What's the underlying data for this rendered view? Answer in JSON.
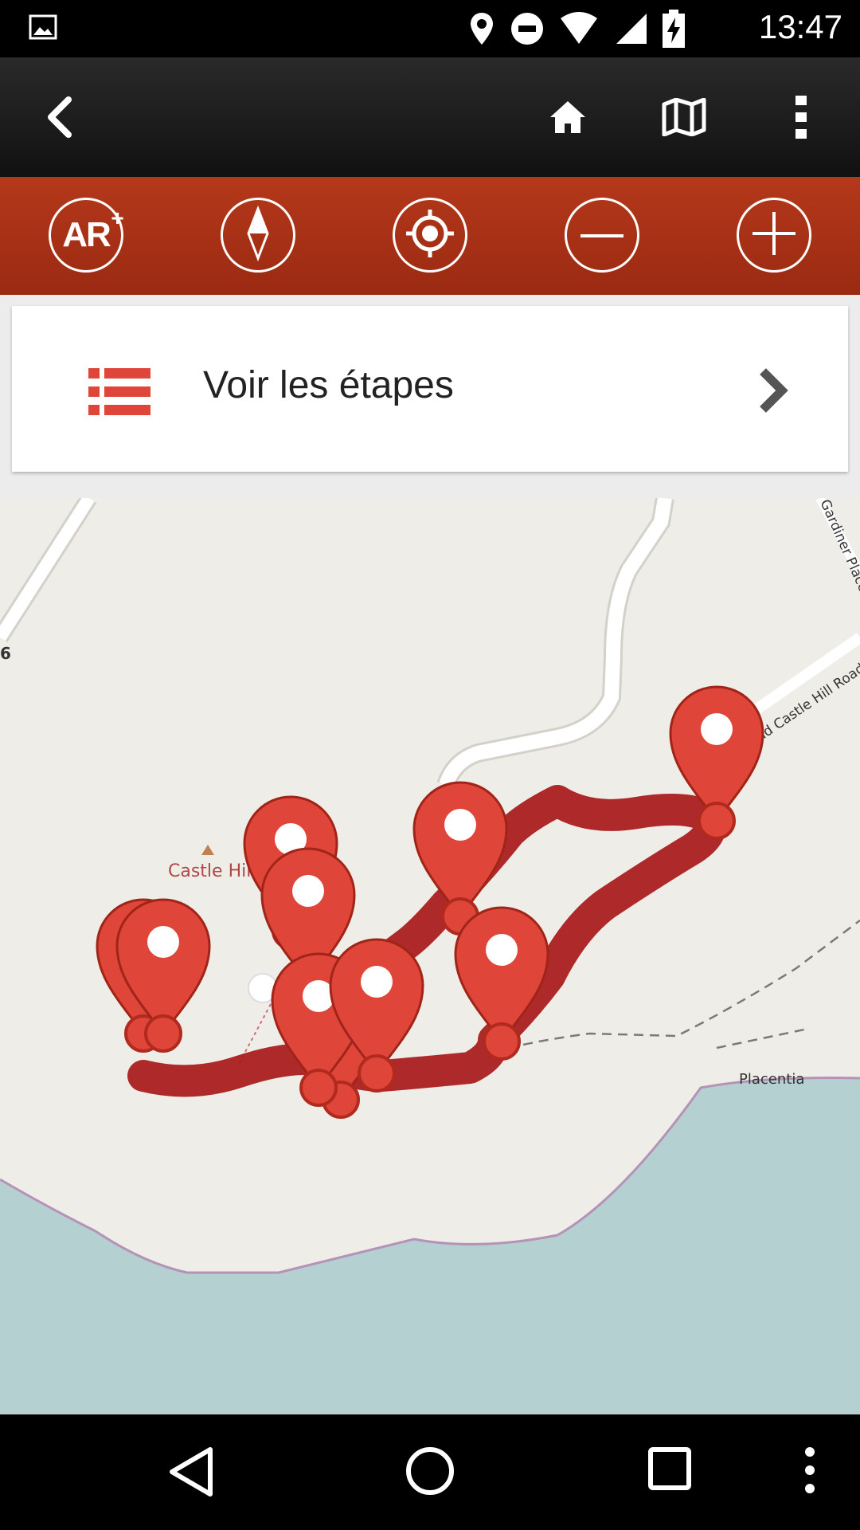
{
  "status_bar": {
    "time": "13:47",
    "icons": [
      "image-icon",
      "location-icon",
      "do-not-disturb-icon",
      "wifi-icon",
      "signal-icon",
      "battery-charging-icon"
    ]
  },
  "app_bar": {
    "icons": [
      "back-icon",
      "home-icon",
      "map-icon",
      "more-vert-icon"
    ]
  },
  "map_toolbar": {
    "ar_label": "AR",
    "ar_plus": "+",
    "icons": [
      "ar-icon",
      "compass-icon",
      "locate-icon",
      "zoom-out-icon",
      "zoom-in-icon"
    ]
  },
  "steps_card": {
    "label": "Voir les étapes",
    "icon": "list-icon",
    "chevron": "chevron-right-icon"
  },
  "map": {
    "labels": {
      "castle_hill": "Castle Hill",
      "road_number": "6",
      "old_castle_hill_road": "Old Castle Hill Road",
      "gardiner_place": "Gardiner Place",
      "placentia": "Placentia"
    },
    "colors": {
      "land": "#efede8",
      "water": "#b5d0d0",
      "route": "#b71c1c",
      "marker": "#e0453a",
      "toolbar": "#a83116"
    }
  },
  "nav_bar": {
    "icons": [
      "back-triangle-icon",
      "home-circle-icon",
      "recents-square-icon",
      "more-vert-icon"
    ]
  }
}
